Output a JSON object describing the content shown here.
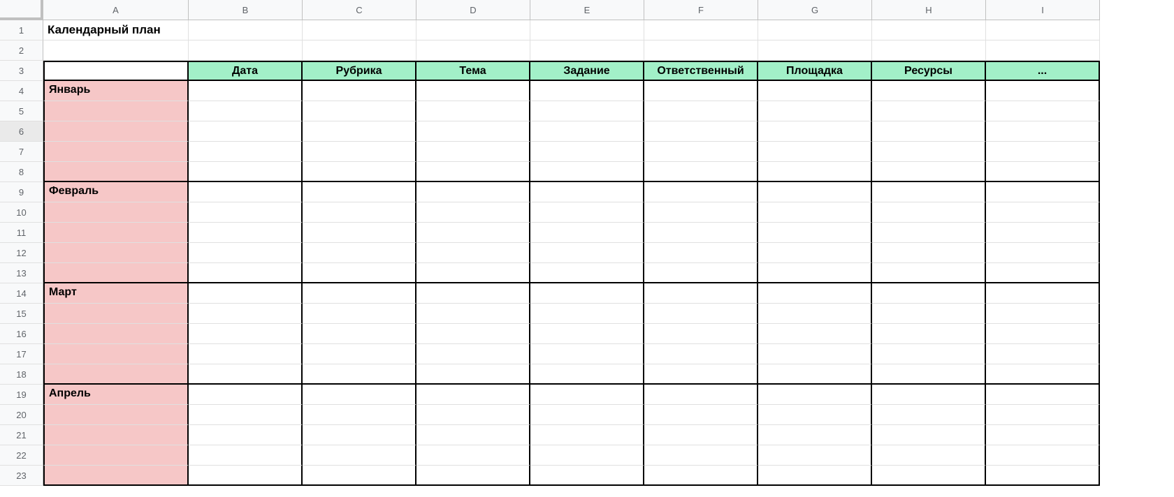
{
  "columns": [
    "A",
    "B",
    "C",
    "D",
    "E",
    "F",
    "G",
    "H",
    "I"
  ],
  "title": "Календарный план",
  "headers": {
    "a": "",
    "b": "Дата",
    "c": "Рубрика",
    "d": "Тема",
    "e": "Задание",
    "f": "Ответственный",
    "g": "Площадка",
    "h": "Ресурсы",
    "i": "..."
  },
  "months": {
    "jan": "Январь",
    "feb": "Февраль",
    "mar": "Март",
    "apr": "Апрель"
  },
  "rows": [
    "1",
    "2",
    "3",
    "4",
    "5",
    "6",
    "7",
    "8",
    "9",
    "10",
    "11",
    "12",
    "13",
    "14",
    "15",
    "16",
    "17",
    "18",
    "19",
    "20",
    "21",
    "22",
    "23"
  ]
}
